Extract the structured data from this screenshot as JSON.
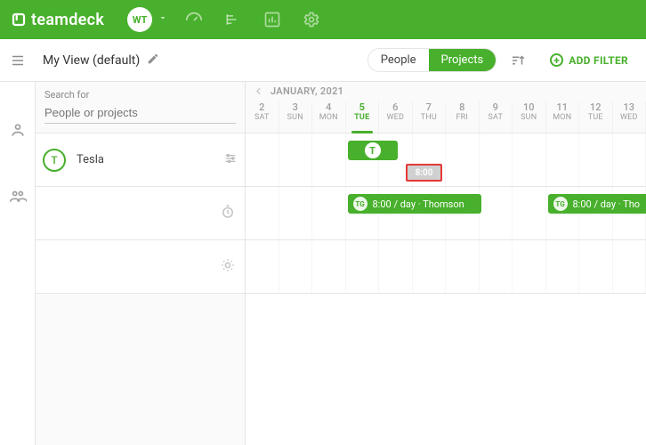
{
  "brand": "teamdeck",
  "workspace_initials": "WT",
  "view": {
    "name": "My View (default)"
  },
  "pills": {
    "people": "People",
    "projects": "Projects",
    "active": "projects"
  },
  "add_filter_label": "ADD FILTER",
  "search": {
    "label": "Search for",
    "placeholder": "People or projects"
  },
  "month": "JANUARY, 2021",
  "days": [
    {
      "num": "2",
      "name": "SAT"
    },
    {
      "num": "3",
      "name": "SUN"
    },
    {
      "num": "4",
      "name": "MON"
    },
    {
      "num": "5",
      "name": "TUE",
      "today": true
    },
    {
      "num": "6",
      "name": "WED"
    },
    {
      "num": "7",
      "name": "THU"
    },
    {
      "num": "8",
      "name": "FRI"
    },
    {
      "num": "9",
      "name": "SAT"
    },
    {
      "num": "10",
      "name": "SUN"
    },
    {
      "num": "11",
      "name": "MON"
    },
    {
      "num": "12",
      "name": "TUE"
    },
    {
      "num": "13",
      "name": "WED"
    }
  ],
  "project": {
    "name": "Tesla",
    "initial": "T"
  },
  "marker_value": "8:00",
  "today_badge": "T",
  "bookings": [
    {
      "avatar": "TG",
      "label": "8:00 / day · Thomson"
    },
    {
      "avatar": "TG",
      "label": "8:00 / day · Tho"
    }
  ]
}
